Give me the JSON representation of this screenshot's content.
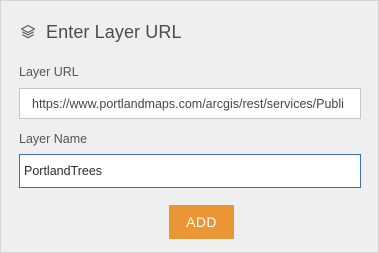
{
  "header": {
    "icon": "layers-icon",
    "title": "Enter Layer URL"
  },
  "form": {
    "url_label": "Layer URL",
    "url_value": "https://www.portlandmaps.com/arcgis/rest/services/Publi",
    "name_label": "Layer Name",
    "name_value": "PortlandTrees",
    "add_label": "ADD"
  },
  "colors": {
    "panel_background": "#efefef",
    "accent_button": "#eb9635",
    "focus_border": "#3b6fb6",
    "title_text": "#4c4c4c"
  }
}
